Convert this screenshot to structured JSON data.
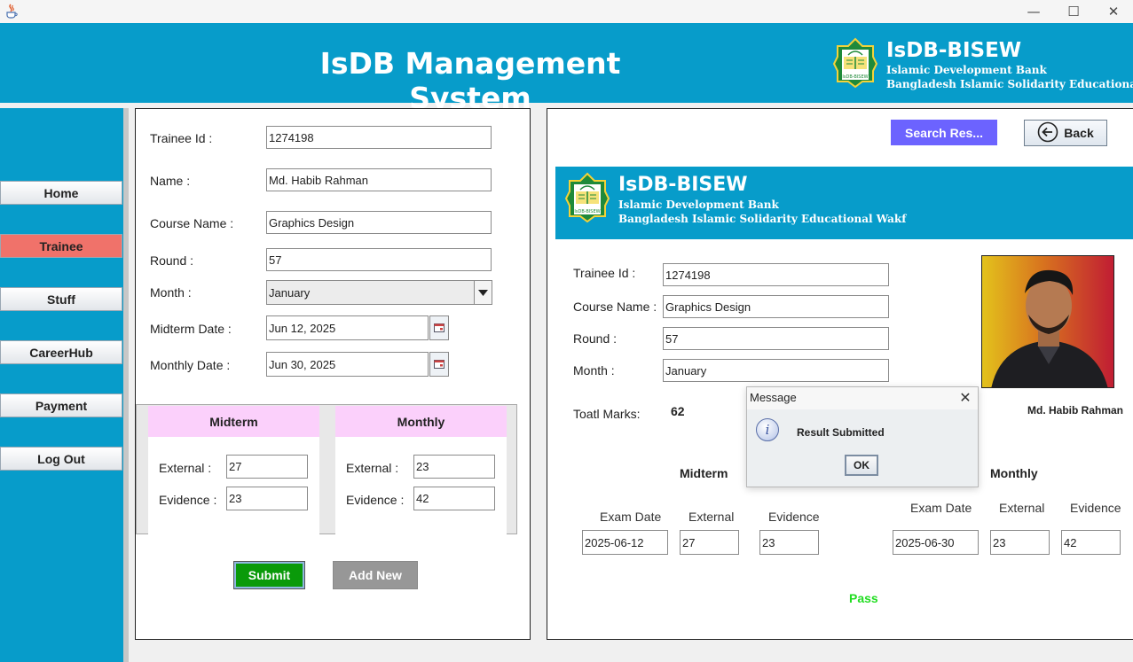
{
  "window": {
    "minimize": "—",
    "maximize": "☐",
    "close": "✕"
  },
  "header": {
    "title": "IsDB Management System",
    "brand_name": "IsDB-BISEW",
    "brand_line1": "Islamic Development Bank",
    "brand_line2": "Bangladesh Islamic Solidarity Educational Wakf",
    "logo_text": "IsDB-BISEW"
  },
  "sidebar": {
    "items": [
      "Home",
      "Trainee",
      "Stuff",
      "CareerHub",
      "Payment",
      "Log Out"
    ],
    "active": "Trainee"
  },
  "form": {
    "trainee_id_label": "Trainee Id :",
    "trainee_id": "1274198",
    "name_label": "Name :",
    "name": "Md. Habib Rahman",
    "course_label": "Course Name :",
    "course": "Graphics Design",
    "round_label": "Round :",
    "round": "57",
    "month_label": "Month :",
    "month": "January",
    "midterm_date_label": "Midterm Date :",
    "midterm_date": "Jun 12, 2025",
    "monthly_date_label": "Monthly Date :",
    "monthly_date": "Jun 30, 2025",
    "midterm": {
      "heading": "Midterm",
      "external_label": "External :",
      "external": "27",
      "evidence_label": "Evidence :",
      "evidence": "23"
    },
    "monthly": {
      "heading": "Monthly",
      "external_label": "External :",
      "external": "23",
      "evidence_label": "Evidence :",
      "evidence": "42"
    },
    "submit_label": "Submit",
    "add_new_label": "Add New"
  },
  "result": {
    "search_label": "Search Res...",
    "back_label": "Back",
    "trainee_id_label": "Trainee Id :",
    "trainee_id": "1274198",
    "course_label": "Course Name :",
    "course": "Graphics Design",
    "round_label": "Round :",
    "round": "57",
    "month_label": "Month :",
    "month": "January",
    "total_label": "Toatl Marks:",
    "total": "62",
    "name": "Md. Habib Rahman",
    "midterm": {
      "heading": "Midterm",
      "exam_date_label": "Exam Date",
      "external_label": "External",
      "evidence_label": "Evidence",
      "exam_date": "2025-06-12",
      "external": "27",
      "evidence": "23"
    },
    "monthly": {
      "heading": "Monthly",
      "exam_date_label": "Exam Date",
      "external_label": "External",
      "evidence_label": "Evidence",
      "exam_date": "2025-06-30",
      "external": "23",
      "evidence": "42"
    },
    "status": "Pass"
  },
  "dialog": {
    "title": "Message",
    "message": "Result Submitted",
    "ok_label": "OK",
    "close": "✕",
    "icon_glyph": "i"
  },
  "colors": {
    "brand": "#079cca",
    "active_nav": "#f0726a",
    "submit": "#0a9a0a",
    "search": "#6c63ff",
    "pass": "#22dd22",
    "marks_header": "#fbd0fb"
  }
}
